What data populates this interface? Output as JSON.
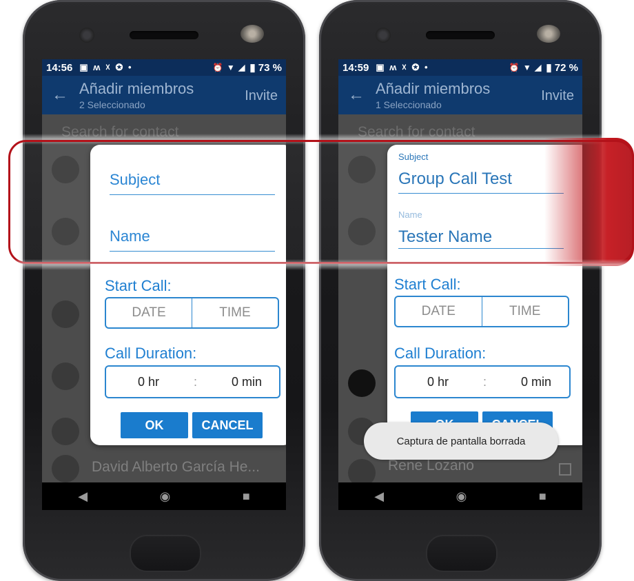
{
  "left": {
    "status": {
      "time": "14:56",
      "left_icons": "▣ ʍ ☓ ✪ •",
      "right_icons": "⏰ ▼ ◢",
      "battery": "▮ 73 %"
    },
    "appbar": {
      "title": "Añadir miembros",
      "subtitle": "2 Seleccionado",
      "invite": "Invite"
    },
    "search_placeholder": "Search for contact",
    "bg_contact": "David Alberto García He...",
    "dialog": {
      "subject_label": "Subject",
      "name_label": "Name",
      "start_call": "Start Call:",
      "date": "DATE",
      "time": "TIME",
      "call_duration": "Call Duration:",
      "hours": "0 hr",
      "separator": ":",
      "minutes": "0 min",
      "ok": "OK",
      "cancel": "CANCEL"
    }
  },
  "right": {
    "status": {
      "time": "14:59",
      "left_icons": "▣ ʍ ☓ ✪ •",
      "right_icons": "⏰ ▼ ◢",
      "battery": "▮ 72 %"
    },
    "appbar": {
      "title": "Añadir miembros",
      "subtitle": "1 Seleccionado",
      "invite": "Invite"
    },
    "search_placeholder": "Search for contact",
    "bg_contact": "Rene Lozano",
    "dialog": {
      "subject_label": "Subject",
      "subject_value": "Group Call Test",
      "name_label": "Name",
      "name_value": "Tester Name",
      "start_call": "Start Call:",
      "date": "DATE",
      "time": "TIME",
      "call_duration": "Call Duration:",
      "hours": "0 hr",
      "separator": ":",
      "minutes": "0 min",
      "ok": "OK",
      "cancel": "CANCEL"
    },
    "toast": "Captura de pantalla borrada"
  },
  "nav": {
    "back": "◀",
    "home": "◉",
    "recents": "■"
  },
  "colors": {
    "accent": "#1a7ccd",
    "appbar": "#0f3a6e",
    "highlight": "#b3121a"
  }
}
